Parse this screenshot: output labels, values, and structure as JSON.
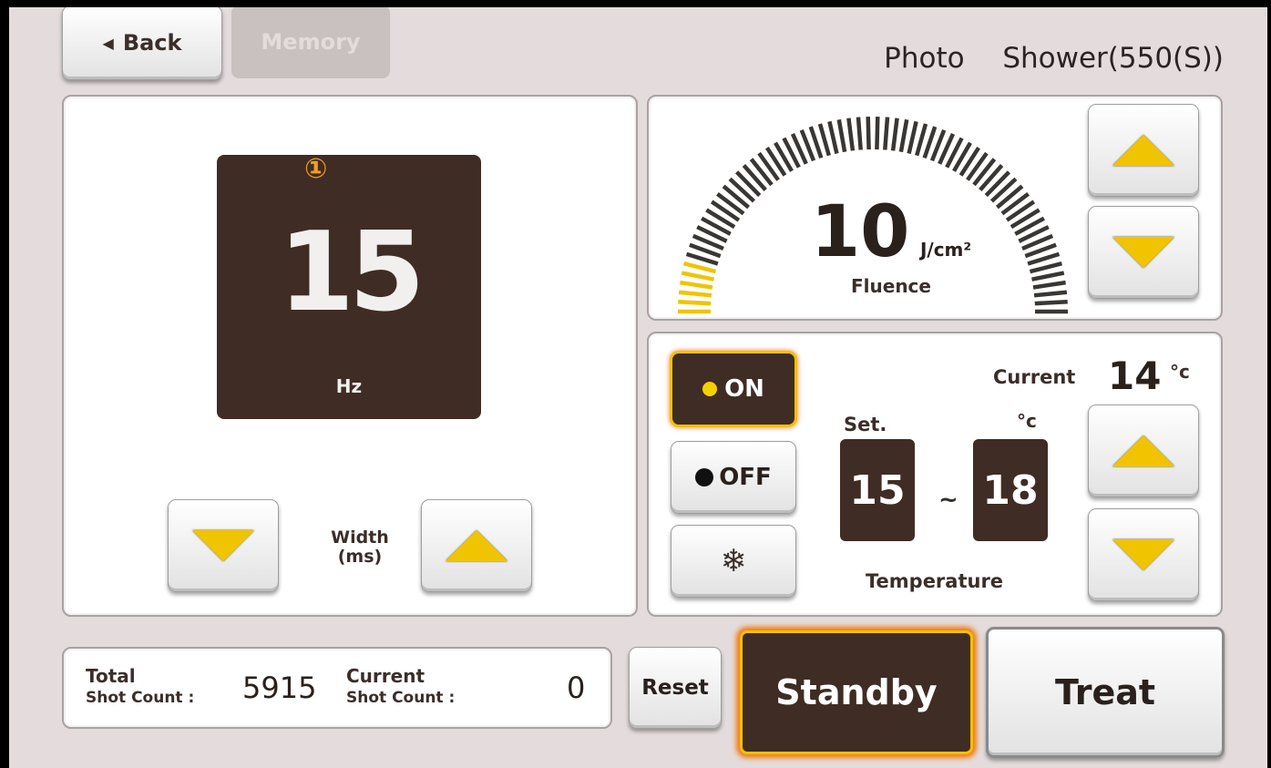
{
  "header": {
    "back_label": "Back",
    "memory_label": "Memory",
    "mode_label": "Photo",
    "filter_label": "Shower(550(S))"
  },
  "pulse_panel": {
    "marker": "①",
    "value": "15",
    "unit": "Hz",
    "width_label_line1": "Width",
    "width_label_line2": "(ms)"
  },
  "fluence_panel": {
    "value": "10",
    "unit": "J/cm²",
    "label": "Fluence",
    "level_fraction": 0.1
  },
  "cooling_panel": {
    "on_label": "ON",
    "off_label": "OFF",
    "snowflake_glyph": "❄",
    "current_label": "Current",
    "current_value": "14",
    "current_unit": "°c",
    "set_label": "Set.",
    "set_unit": "°c",
    "set_low": "15",
    "range_sep": "~",
    "set_high": "18",
    "temperature_label": "Temperature"
  },
  "counter": {
    "total_label_line1": "Total",
    "total_label_line2": "Shot Count :",
    "total_value": "5915",
    "current_label_line1": "Current",
    "current_label_line2": "Shot Count :",
    "current_value": "0"
  },
  "actions": {
    "reset_label": "Reset",
    "standby_label": "Standby",
    "treat_label": "Treat"
  },
  "colors": {
    "accent_yellow": "#f0c400",
    "dark_brown": "#3f2c24",
    "standby_glow": "#f07a10",
    "background": "#e4dcdc"
  }
}
